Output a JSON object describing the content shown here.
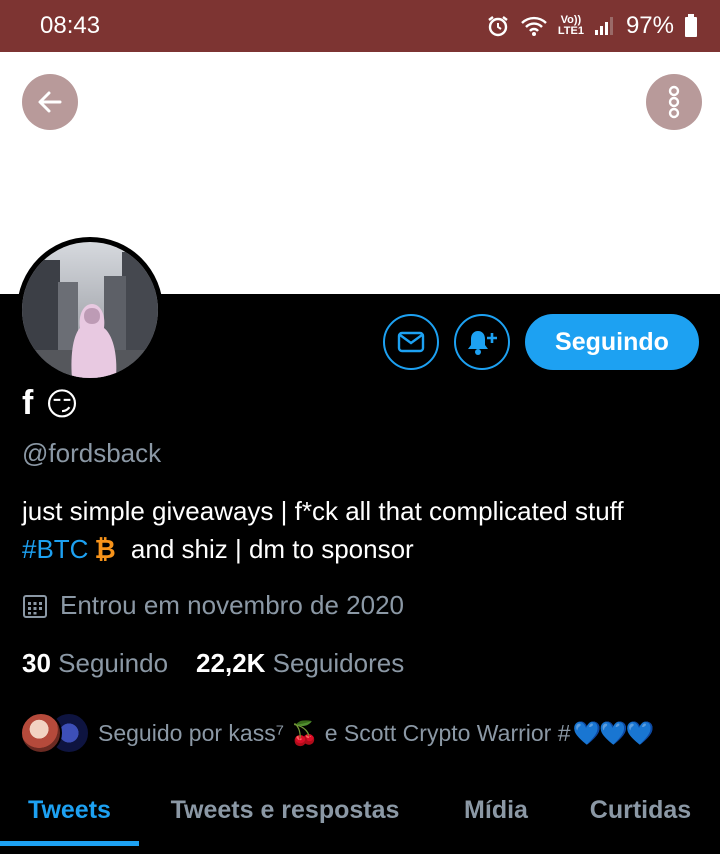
{
  "status_bar": {
    "time": "08:43",
    "lte_top": "Vo))",
    "lte_bottom": "LTE1",
    "battery": "97%"
  },
  "profile": {
    "name": "f",
    "name_emoji": "😏",
    "handle": "@fordsback",
    "bio_line1": "just simple giveaways | f*ck all that complicated stuff",
    "bio_hashtag": "#BTC",
    "bio_btc_glyph": "₿",
    "bio_line2_rest": "and shiz | dm to sponsor",
    "joined": "Entrou em novembro de 2020",
    "following_count": "30",
    "following_label": "Seguindo",
    "followers_count": "22,2K",
    "followers_label": "Seguidores",
    "followed_by_prefix": "Seguido por kass⁷",
    "followed_by_cherry": "🍒",
    "followed_by_suffix": "e Scott Crypto Warrior #",
    "followed_by_hearts": "💙💙💙"
  },
  "actions": {
    "follow_label": "Seguindo"
  },
  "tabs": [
    {
      "label": "Tweets",
      "active": true
    },
    {
      "label": "Tweets e respostas",
      "active": false
    },
    {
      "label": "Mídia",
      "active": false
    },
    {
      "label": "Curtidas",
      "active": false
    }
  ],
  "colors": {
    "accent": "#1da1f2",
    "status_bar": "#7d3432",
    "muted": "#8b98a5",
    "btc": "#f7931a"
  }
}
